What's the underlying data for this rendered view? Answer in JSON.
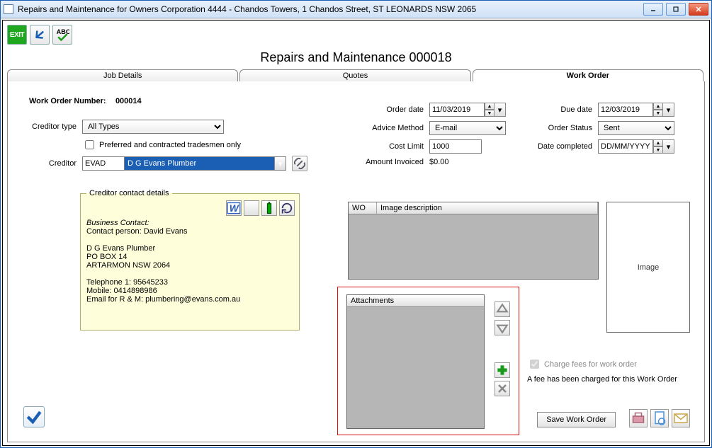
{
  "window": {
    "title": "Repairs and Maintenance for Owners Corporation 4444 - Chandos Towers, 1 Chandos Street, ST LEONARDS  NSW  2065"
  },
  "toolbar": {
    "exit": "EXIT"
  },
  "page_title": "Repairs and Maintenance 000018",
  "tabs": {
    "job": "Job Details",
    "quotes": "Quotes",
    "work_order": "Work Order"
  },
  "left": {
    "wonum_label": "Work Order Number:",
    "wonum": "000014",
    "creditor_type_label": "Creditor type",
    "creditor_type": "All Types",
    "preferred_chk": "Preferred and contracted tradesmen only",
    "creditor_label": "Creditor",
    "creditor_code": "EVAD",
    "creditor_name": "D G Evans Plumber",
    "details_legend": "Creditor contact details",
    "bc_heading": "Business Contact:",
    "contact_person": "Contact person: David Evans",
    "line1": "D G Evans Plumber",
    "line2": "PO BOX 14",
    "line3": "ARTARMON  NSW  2064",
    "tel": "Telephone 1: 95645233",
    "mob": "Mobile: 0414898986",
    "email": "Email for R & M: plumbering@evans.com.au"
  },
  "right": {
    "order_date_lbl": "Order date",
    "order_date": "11/03/2019",
    "due_date_lbl": "Due date",
    "due_date": "12/03/2019",
    "advice_lbl": "Advice Method",
    "advice": "E-mail",
    "status_lbl": "Order Status",
    "status": "Sent",
    "cost_lbl": "Cost Limit",
    "cost": "1000",
    "completed_lbl": "Date completed",
    "completed": "DD/MM/YYYY",
    "invoiced_lbl": "Amount Invoiced",
    "invoiced": "$0.00"
  },
  "grid": {
    "col1": "WO",
    "col2": "Image description"
  },
  "imgbox": "Image",
  "attachments": {
    "header": "Attachments"
  },
  "fees": {
    "chk": "Charge fees for work order",
    "msg": "A fee has been charged for this Work Order"
  },
  "save": "Save Work Order"
}
